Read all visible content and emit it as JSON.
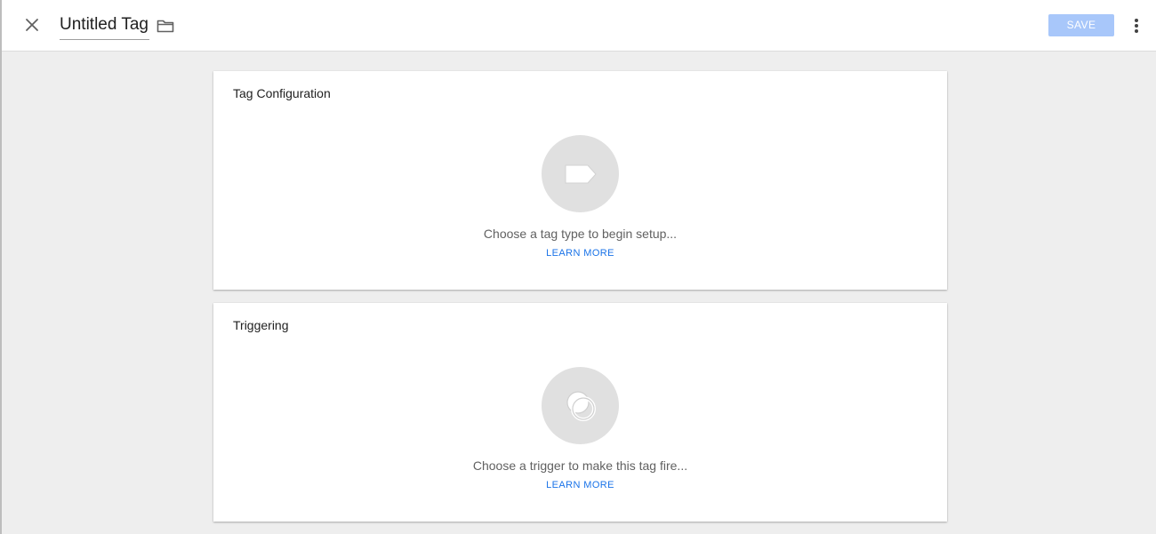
{
  "header": {
    "title": "Untitled Tag",
    "save_label": "SAVE",
    "icons": {
      "close": "close-icon",
      "folder": "folder-icon",
      "more": "more-vert-icon"
    }
  },
  "tag_configuration": {
    "title": "Tag Configuration",
    "icon": "tag-icon",
    "hint": "Choose a tag type to begin setup...",
    "learn_more": "LEARN MORE"
  },
  "triggering": {
    "title": "Triggering",
    "icon": "trigger-icon",
    "hint": "Choose a trigger to make this tag fire...",
    "learn_more": "LEARN MORE"
  },
  "colors": {
    "accent": "#1a73e8",
    "save_disabled": "#a8c7fa",
    "background": "#eeeeee",
    "icon_circle": "#e0e0e0"
  }
}
